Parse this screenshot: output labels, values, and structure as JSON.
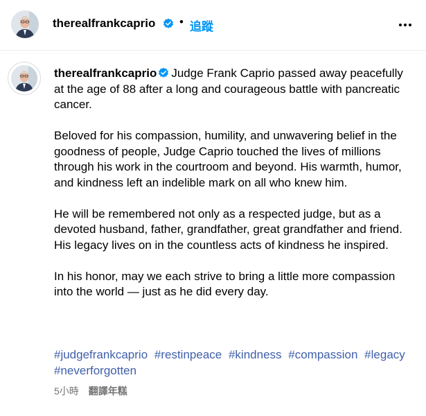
{
  "header": {
    "username": "therealfrankcaprio",
    "separator": "•",
    "follow_label": "追蹤",
    "verified_icon": "verified-badge-icon",
    "more_icon": "more-options-icon"
  },
  "post": {
    "username": "therealfrankcaprio",
    "paragraphs": [
      "Judge Frank Caprio passed away peacefully at the age of 88 after a long and courageous battle with pancreatic cancer.",
      "Beloved for his compassion, humility, and unwavering belief in the goodness of people, Judge Caprio touched the lives of millions through his work in the courtroom and beyond. His warmth, humor, and kindness left an indelible mark on all who knew him.",
      "He will be remembered not only as a respected judge, but as a devoted husband, father, grandfather, great grandfather and friend. His legacy lives on in the countless acts of kindness he inspired.",
      "In his honor, may we each strive to bring a little more compassion into the world — just as he did every day."
    ],
    "hashtags": [
      "#judgefrankcaprio",
      "#restinpeace",
      "#kindness",
      "#compassion",
      "#legacy",
      "#neverforgotten"
    ],
    "time_ago": "5小時",
    "translate_label": "翻譯年糕"
  },
  "colors": {
    "link_blue": "#0095f6",
    "hashtag_blue": "#3f5faa",
    "muted_text": "#737373",
    "divider": "#efefef"
  }
}
